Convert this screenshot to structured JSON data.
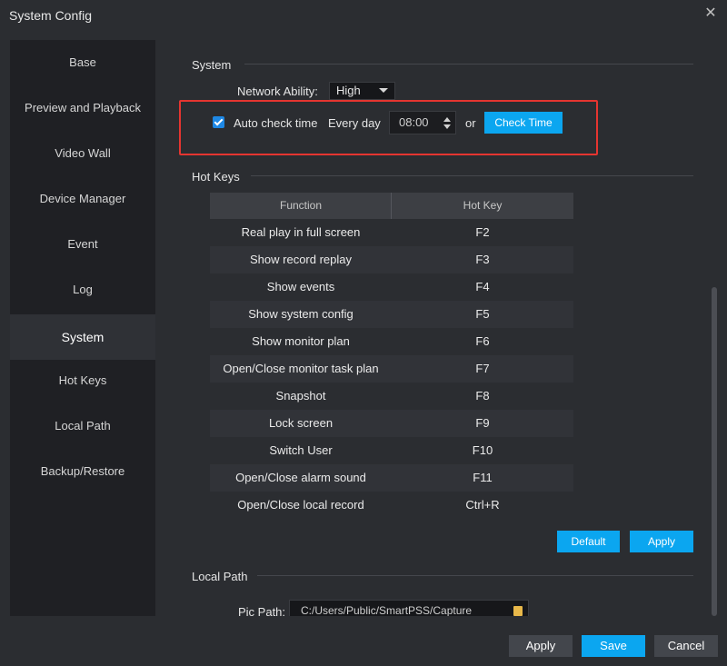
{
  "window": {
    "title": "System Config",
    "close_icon": "close-icon"
  },
  "sidebar": {
    "items": [
      {
        "label": "Base"
      },
      {
        "label": "Preview and Playback"
      },
      {
        "label": "Video Wall"
      },
      {
        "label": "Device Manager"
      },
      {
        "label": "Event"
      },
      {
        "label": "Log"
      },
      {
        "label": "System",
        "active": true
      },
      {
        "label": "Hot Keys"
      },
      {
        "label": "Local Path"
      },
      {
        "label": "Backup/Restore"
      }
    ]
  },
  "system": {
    "section_title": "System",
    "network_ability_label": "Network Ability:",
    "network_ability_value": "High",
    "auto_check_label": "Auto check time",
    "auto_check_checked": true,
    "every_day_label": "Every day",
    "time_value": "08:00",
    "or_label": "or",
    "check_time_button": "Check Time"
  },
  "hotkeys": {
    "section_title": "Hot Keys",
    "columns": [
      "Function",
      "Hot Key"
    ],
    "rows": [
      {
        "function": "Real play in full screen",
        "key": "F2"
      },
      {
        "function": "Show record replay",
        "key": "F3"
      },
      {
        "function": "Show events",
        "key": "F4"
      },
      {
        "function": "Show system config",
        "key": "F5"
      },
      {
        "function": "Show monitor plan",
        "key": "F6"
      },
      {
        "function": "Open/Close monitor task plan",
        "key": "F7"
      },
      {
        "function": "Snapshot",
        "key": "F8"
      },
      {
        "function": "Lock screen",
        "key": "F9"
      },
      {
        "function": "Switch User",
        "key": "F10"
      },
      {
        "function": "Open/Close alarm sound",
        "key": "F11"
      },
      {
        "function": "Open/Close local record",
        "key": "Ctrl+R"
      }
    ],
    "default_button": "Default",
    "apply_button": "Apply"
  },
  "local_path": {
    "section_title": "Local Path",
    "pic_path_label": "Pic Path:",
    "pic_path_value": "C:/Users/Public/SmartPSS/Capture"
  },
  "footer": {
    "apply": "Apply",
    "save": "Save",
    "cancel": "Cancel"
  },
  "colors": {
    "accent": "#0ba6f0",
    "highlight_border": "#e53530",
    "background": "#2b2d31",
    "sidebar_bg": "#1f2024"
  }
}
